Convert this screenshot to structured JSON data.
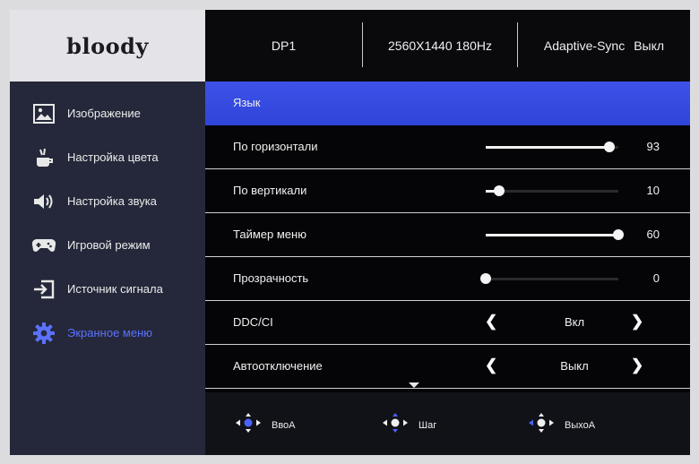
{
  "logo": {
    "text": "bloody"
  },
  "header": {
    "input": "DP1",
    "resolution": "2560X1440 180Hz",
    "sync_label": "Adaptive-Sync",
    "sync_value": "Выкл"
  },
  "sidebar": {
    "items": [
      {
        "label": "Изображение",
        "icon": "image-icon"
      },
      {
        "label": "Настройка цвета",
        "icon": "color-palette-icon"
      },
      {
        "label": "Настройка звука",
        "icon": "speaker-icon"
      },
      {
        "label": "Игровой режим",
        "icon": "gamepad-icon"
      },
      {
        "label": "Источник сигнала",
        "icon": "input-source-icon"
      },
      {
        "label": "Экранное меню",
        "icon": "gear-icon",
        "active": true
      }
    ],
    "active_color": "#5b71ff"
  },
  "menu": {
    "rows": [
      {
        "label": "Язык",
        "selected": true
      },
      {
        "label": "По горизонтали",
        "value": "93",
        "level": 93
      },
      {
        "label": "По вертикали",
        "value": "10",
        "level": 10
      },
      {
        "label": "Таймер меню",
        "value": "60",
        "level": 100
      },
      {
        "label": "Прозрачность",
        "value": "0",
        "level": 0
      },
      {
        "label": "DDC/CI",
        "option": "Вкл",
        "left_arrow": "❮",
        "right_arrow": "❯"
      },
      {
        "label": "Автоотключение",
        "option": "Выкл",
        "left_arrow": "❮",
        "right_arrow": "❯"
      }
    ],
    "highlight_color": "#3547e0"
  },
  "footer": {
    "enter_label": "ВвоА",
    "step_label": "Шаг",
    "exit_label": "ВыхоА"
  }
}
